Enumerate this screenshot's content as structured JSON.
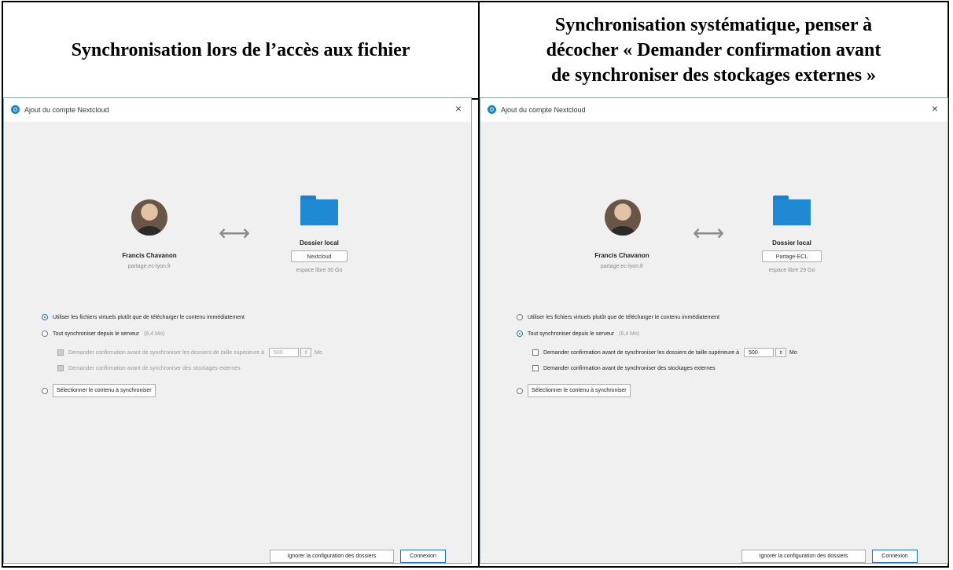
{
  "headers": {
    "left": "Synchronisation lors de l’accès aux fichier",
    "right_lines": [
      "Synchronisation systématique, penser à",
      "décocher « Demander confirmation avant",
      "de synchroniser des stockages externes »"
    ]
  },
  "dialogs": [
    {
      "title": "Ajout du compte Nextcloud",
      "user_name": "Francis Chavanon",
      "server": "partage.ec-lyon.fr",
      "local_title": "Dossier local",
      "folder_name": "Nextcloud",
      "free_space": "espace libre 30 Go",
      "options": {
        "virtual_files": "Utiliser les fichiers virtuels plutôt que de télécharger le contenu immédiatement",
        "sync_all": "Tout synchroniser depuis le serveur",
        "sync_all_size": "(6,4 Mo)",
        "confirm_large": "Demander confirmation avant de synchroniser les dossiers de taille supérieure à",
        "threshold": "500",
        "unit": "Mo",
        "confirm_external": "Demander confirmation avant de synchroniser des stockages externes",
        "select_content": "Sélectionner le contenu à synchroniser"
      },
      "selected": "virtual_files",
      "checkboxes_enabled": false,
      "buttons": {
        "skip": "Ignorer la configuration des dossiers",
        "connect": "Connexion"
      }
    },
    {
      "title": "Ajout du compte Nextcloud",
      "user_name": "Francis Chavanon",
      "server": "partage.ec-lyon.fr",
      "local_title": "Dossier local",
      "folder_name": "Partage-ECL",
      "free_space": "espace libre 29 Go",
      "options": {
        "virtual_files": "Utiliser les fichiers virtuels plutôt que de télécharger le contenu immédiatement",
        "sync_all": "Tout synchroniser depuis le serveur",
        "sync_all_size": "(6,4 Mo)",
        "confirm_large": "Demander confirmation avant de synchroniser les dossiers de taille supérieure à",
        "threshold": "500",
        "unit": "Mo",
        "confirm_external": "Demander confirmation avant de synchroniser des stockages externes",
        "select_content": "Sélectionner le contenu à synchroniser"
      },
      "selected": "sync_all",
      "checkboxes_enabled": true,
      "buttons": {
        "skip": "Ignorer la configuration des dossiers",
        "connect": "Connexion"
      }
    }
  ],
  "icons": {
    "app": "nextcloud-logo-icon",
    "close": "close-icon",
    "sync": "bidirectional-arrow-icon",
    "folder": "folder-icon"
  },
  "colors": {
    "accent": "#1a82c9",
    "dialog_bg": "#f0f0f0"
  }
}
